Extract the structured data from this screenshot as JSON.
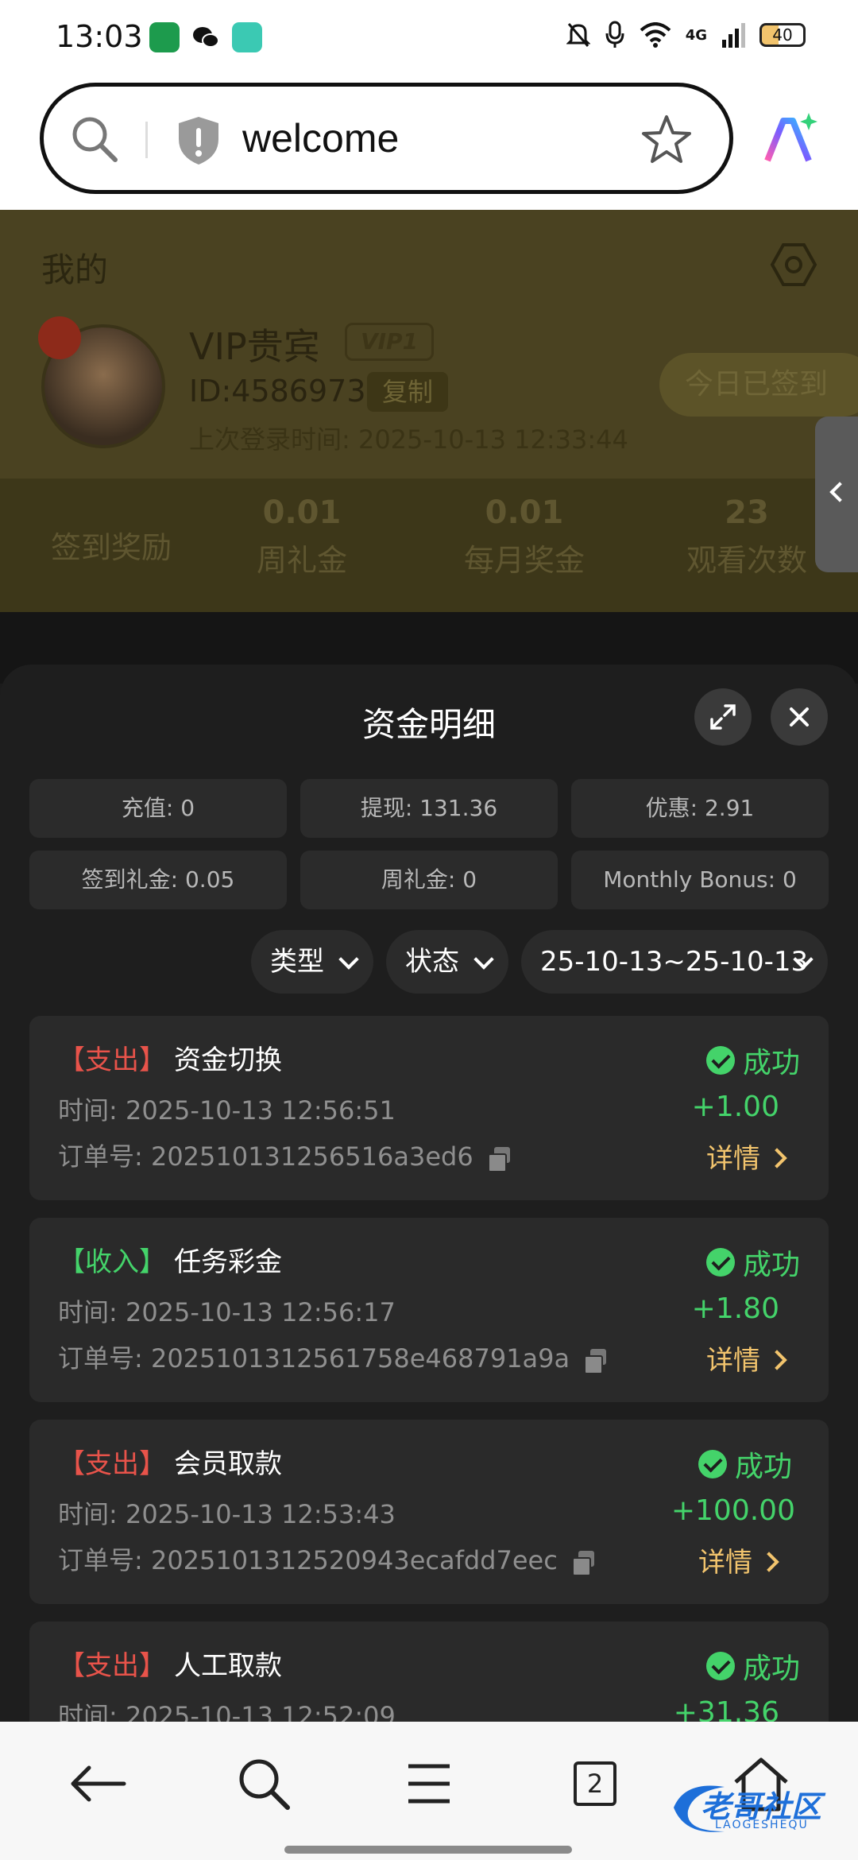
{
  "status_bar": {
    "time": "13:03",
    "battery": "40",
    "network": "4G"
  },
  "browser": {
    "url_text": "welcome"
  },
  "profile": {
    "title": "我的",
    "vip_name": "VIP贵宾",
    "vip_level": "VIP1",
    "user_id": "ID:4586973",
    "copy_label": "复制",
    "last_login": "上次登录时间:   2025-10-13 12:33:44",
    "signed_label": "今日已签到",
    "stats": [
      {
        "num": "",
        "label": "签到奖励"
      },
      {
        "num": "0.01",
        "label": "周礼金"
      },
      {
        "num": "0.01",
        "label": "每月奖金"
      },
      {
        "num": "23",
        "label": "观看次数"
      }
    ]
  },
  "sheet": {
    "title": "资金明细",
    "summary": [
      "充值: 0",
      "提现: 131.36",
      "优惠: 2.91",
      "签到礼金: 0.05",
      "周礼金: 0",
      "Monthly Bonus: 0"
    ],
    "filters": {
      "type": "类型",
      "status": "状态",
      "date": "25-10-13~25-10-13"
    },
    "transactions": [
      {
        "tag": "【支出】",
        "tag_color": "#e8534a",
        "name": "资金切换",
        "time": "时间:   2025-10-13 12:56:51",
        "order": "订单号:  202510131256516a3ed6",
        "status": "成功",
        "amount": "+1.00",
        "detail": "详情"
      },
      {
        "tag": "【收入】",
        "tag_color": "#44d36a",
        "name": "任务彩金",
        "time": "时间:   2025-10-13 12:56:17",
        "order": "订单号:  2025101312561758e468791a9a",
        "status": "成功",
        "amount": "+1.80",
        "detail": "详情"
      },
      {
        "tag": "【支出】",
        "tag_color": "#e8534a",
        "name": "会员取款",
        "time": "时间:   2025-10-13 12:53:43",
        "order": "订单号:  2025101312520943ecafdd7eec",
        "status": "成功",
        "amount": "+100.00",
        "detail": "详情"
      },
      {
        "tag": "【支出】",
        "tag_color": "#e8534a",
        "name": "人工取款",
        "time": "时间:   2025-10-13 12:52:09",
        "order": "",
        "status": "成功",
        "amount": "+31.36",
        "detail": ""
      }
    ]
  },
  "bottom_nav": {
    "tabs_count": "2"
  },
  "watermark": {
    "text": "老哥社区",
    "sub": "LAOGESHEQU"
  }
}
